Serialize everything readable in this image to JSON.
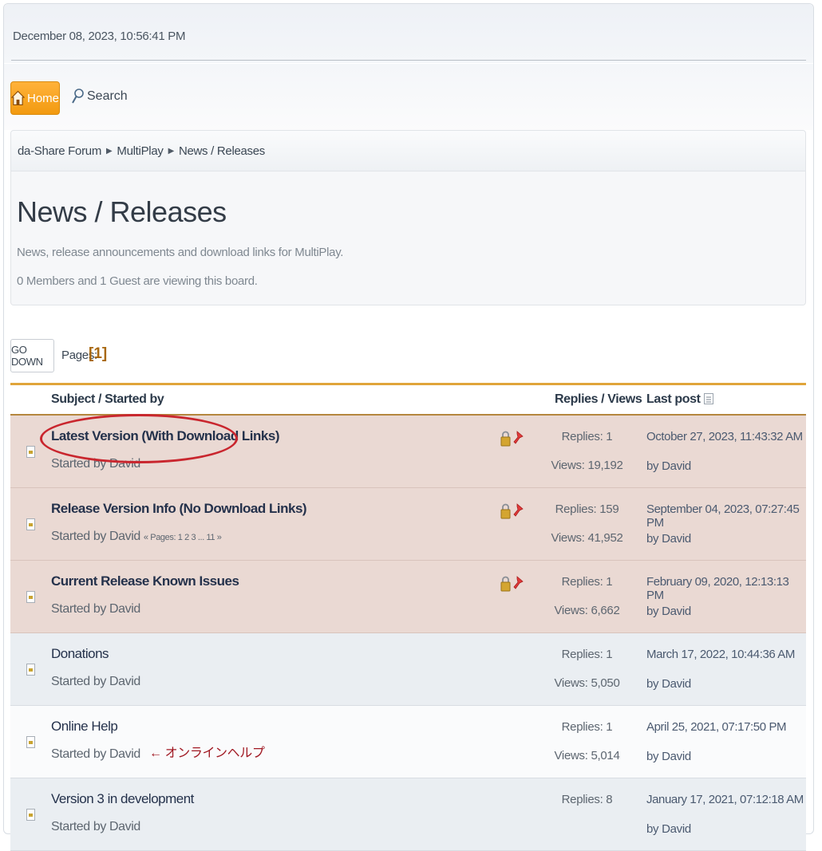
{
  "header": {
    "datetime": "December 08, 2023, 10:56:41 PM"
  },
  "nav": {
    "home": "Home",
    "search": "Search"
  },
  "breadcrumb": [
    "da-Share Forum",
    "MultiPlay",
    "News / Releases"
  ],
  "board": {
    "title": "News / Releases",
    "description": "News, release announcements and download links for MultiPlay.",
    "viewers": "0 Members and 1 Guest are viewing this board."
  },
  "pagination": {
    "go_down": "GO DOWN",
    "pages_label": "Pages:",
    "current": "[1]"
  },
  "table": {
    "col_subject": "Subject / Started by",
    "col_replies": "Replies / Views",
    "col_last": "Last post",
    "rows": [
      {
        "subject": "Latest Version (With Download Links)",
        "starter": "Started by David",
        "replies": "Replies: 1",
        "views": "Views: 19,192",
        "last_date": "October 27, 2023, 11:43:32 AM",
        "last_by": "by David"
      },
      {
        "subject": "Release Version Info (No Download Links)",
        "starter": "Started by David",
        "pages": "« Pages: 1 2 3 ... 11 »",
        "replies": "Replies: 159",
        "views": "Views: 41,952",
        "last_date": "September 04, 2023, 07:27:45 PM",
        "last_by": "by David"
      },
      {
        "subject": "Current Release Known Issues",
        "starter": "Started by David",
        "replies": "Replies: 1",
        "views": "Views: 6,662",
        "last_date": "February 09, 2020, 12:13:13 PM",
        "last_by": "by David"
      },
      {
        "subject": "Donations",
        "starter": "Started by David",
        "replies": "Replies: 1",
        "views": "Views: 5,050",
        "last_date": "March 17, 2022, 10:44:36 AM",
        "last_by": "by David"
      },
      {
        "subject": "Online Help",
        "starter": "Started by David",
        "replies": "Replies: 1",
        "views": "Views: 5,014",
        "last_date": "April 25, 2021, 07:17:50 PM",
        "last_by": "by David"
      },
      {
        "subject": "Version 3 in development",
        "starter": "Started by David",
        "replies": "Replies: 8",
        "views": "",
        "last_date": "January 17, 2021, 07:12:18 AM",
        "last_by": "by David"
      }
    ]
  },
  "annotation": {
    "arrow_note": "← オンラインヘルプ"
  },
  "colors": {
    "accent": "#f29a10",
    "sticky_row": "#ead9d3",
    "table_border": "#e0a53a",
    "annotation": "#c9262e"
  }
}
